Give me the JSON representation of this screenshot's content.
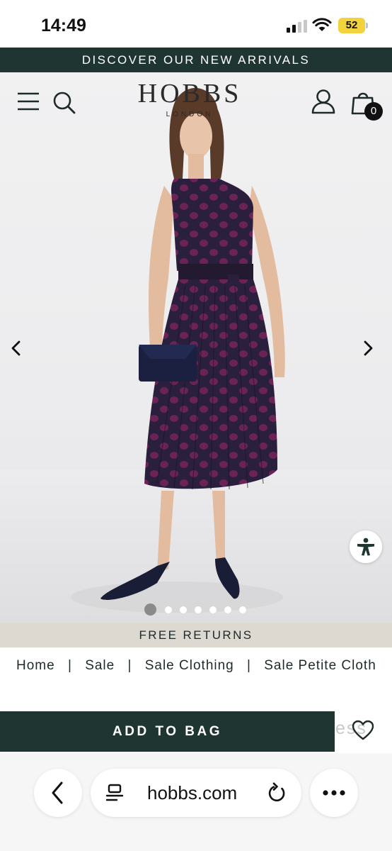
{
  "status_bar": {
    "time": "14:49",
    "battery_level": "52",
    "icons": [
      "signal-icon",
      "wifi-icon",
      "battery-icon"
    ]
  },
  "promo_banner": {
    "text": "DISCOVER OUR NEW ARRIVALS"
  },
  "header": {
    "logo_main": "HOBBS",
    "logo_sub": "LONDON",
    "bag_count": "0",
    "icons": [
      "menu-icon",
      "search-icon",
      "account-icon",
      "bag-icon"
    ]
  },
  "gallery": {
    "image_count": 7,
    "active_index": 0,
    "icons": [
      "chevron-left-icon",
      "chevron-right-icon",
      "accessibility-icon"
    ]
  },
  "returns_banner": {
    "text": "FREE RETURNS"
  },
  "breadcrumb": {
    "items": [
      "Home",
      "Sale",
      "Sale Clothing",
      "Sale Petite Cloth"
    ],
    "separator": "|"
  },
  "actions": {
    "add_to_bag_label": "ADD TO BAG",
    "peek_text": "ess",
    "icons": [
      "heart-icon"
    ]
  },
  "browser": {
    "url": "hobbs.com",
    "icons": [
      "back-icon",
      "tabs-icon",
      "reload-icon",
      "more-icon"
    ]
  },
  "colors": {
    "brand_dark": "#1f3532",
    "returns_banner": "#ddd8d0",
    "battery": "#f2d33c"
  }
}
